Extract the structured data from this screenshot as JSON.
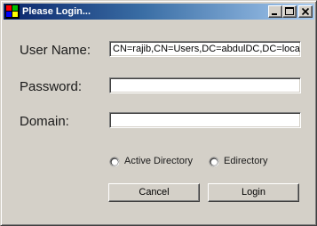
{
  "window": {
    "title": "Please Login...",
    "icon": "windows-app-icon",
    "controls": [
      "minimize-icon",
      "maximize-icon",
      "close-icon"
    ]
  },
  "form": {
    "username": {
      "label": "User Name:",
      "value": "CN=rajib,CN=Users,DC=abdulDC,DC=local"
    },
    "password": {
      "label": "Password:",
      "value": ""
    },
    "domain": {
      "label": "Domain:",
      "value": ""
    }
  },
  "directory_type": {
    "options": [
      "Active Directory",
      "Edirectory"
    ],
    "selected": null
  },
  "buttons": {
    "cancel": "Cancel",
    "login": "Login"
  },
  "colors": {
    "face": "#d4d0c8",
    "titlebar_start": "#0a246a",
    "titlebar_end": "#a6caf0"
  }
}
